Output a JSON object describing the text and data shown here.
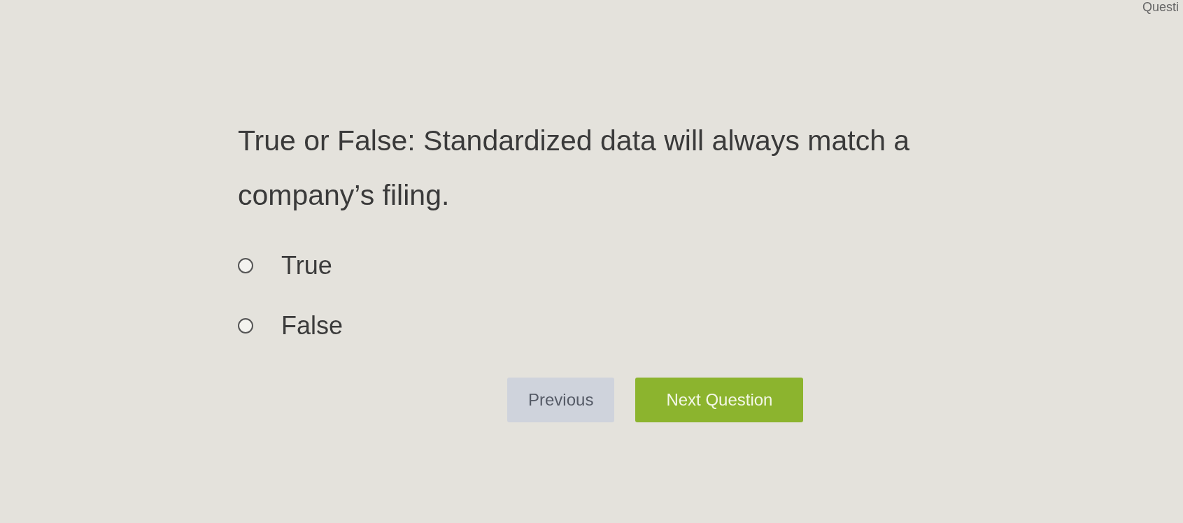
{
  "corner_label": "Questi",
  "question": "True or False: Standardized data will always match a company’s filing.",
  "options": [
    {
      "label": "True",
      "selected": false
    },
    {
      "label": "False",
      "selected": false
    }
  ],
  "buttons": [
    {
      "label": "Previous",
      "kind": "secondary"
    },
    {
      "label": "Next Question",
      "kind": "primary"
    }
  ]
}
